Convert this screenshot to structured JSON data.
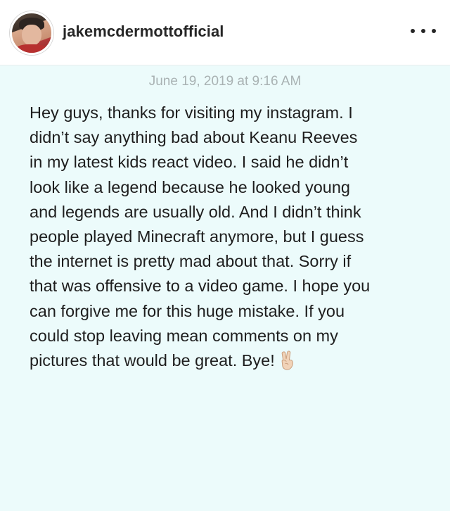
{
  "post": {
    "username": "jakemcdermottofficial",
    "more_icon": "more-horizontal-icon",
    "avatar_icon": "profile-avatar"
  },
  "note": {
    "date": "June 19, 2019 at 9:16 AM",
    "body": "Hey guys, thanks for visiting my instagram. I\ndidn’t say anything bad about Keanu Reeves\nin my latest kids react video. I said he didn’t\nlook like a legend because he looked young\nand legends are usually old. And I didn’t think\npeople played Minecraft anymore, but I guess\nthe internet is pretty mad about that. Sorry if\nthat was offensive to a video game. I hope you\ncan forgive me for this huge mistake. If you\ncould stop leaving mean comments on my\npictures that would be great. Bye!",
    "emoji_icon": "victory-hand-emoji"
  },
  "colors": {
    "note_background": "#ecfbfb",
    "date_text": "#a9b2b3",
    "body_text": "#1e1e1e",
    "username_text": "#262626"
  }
}
